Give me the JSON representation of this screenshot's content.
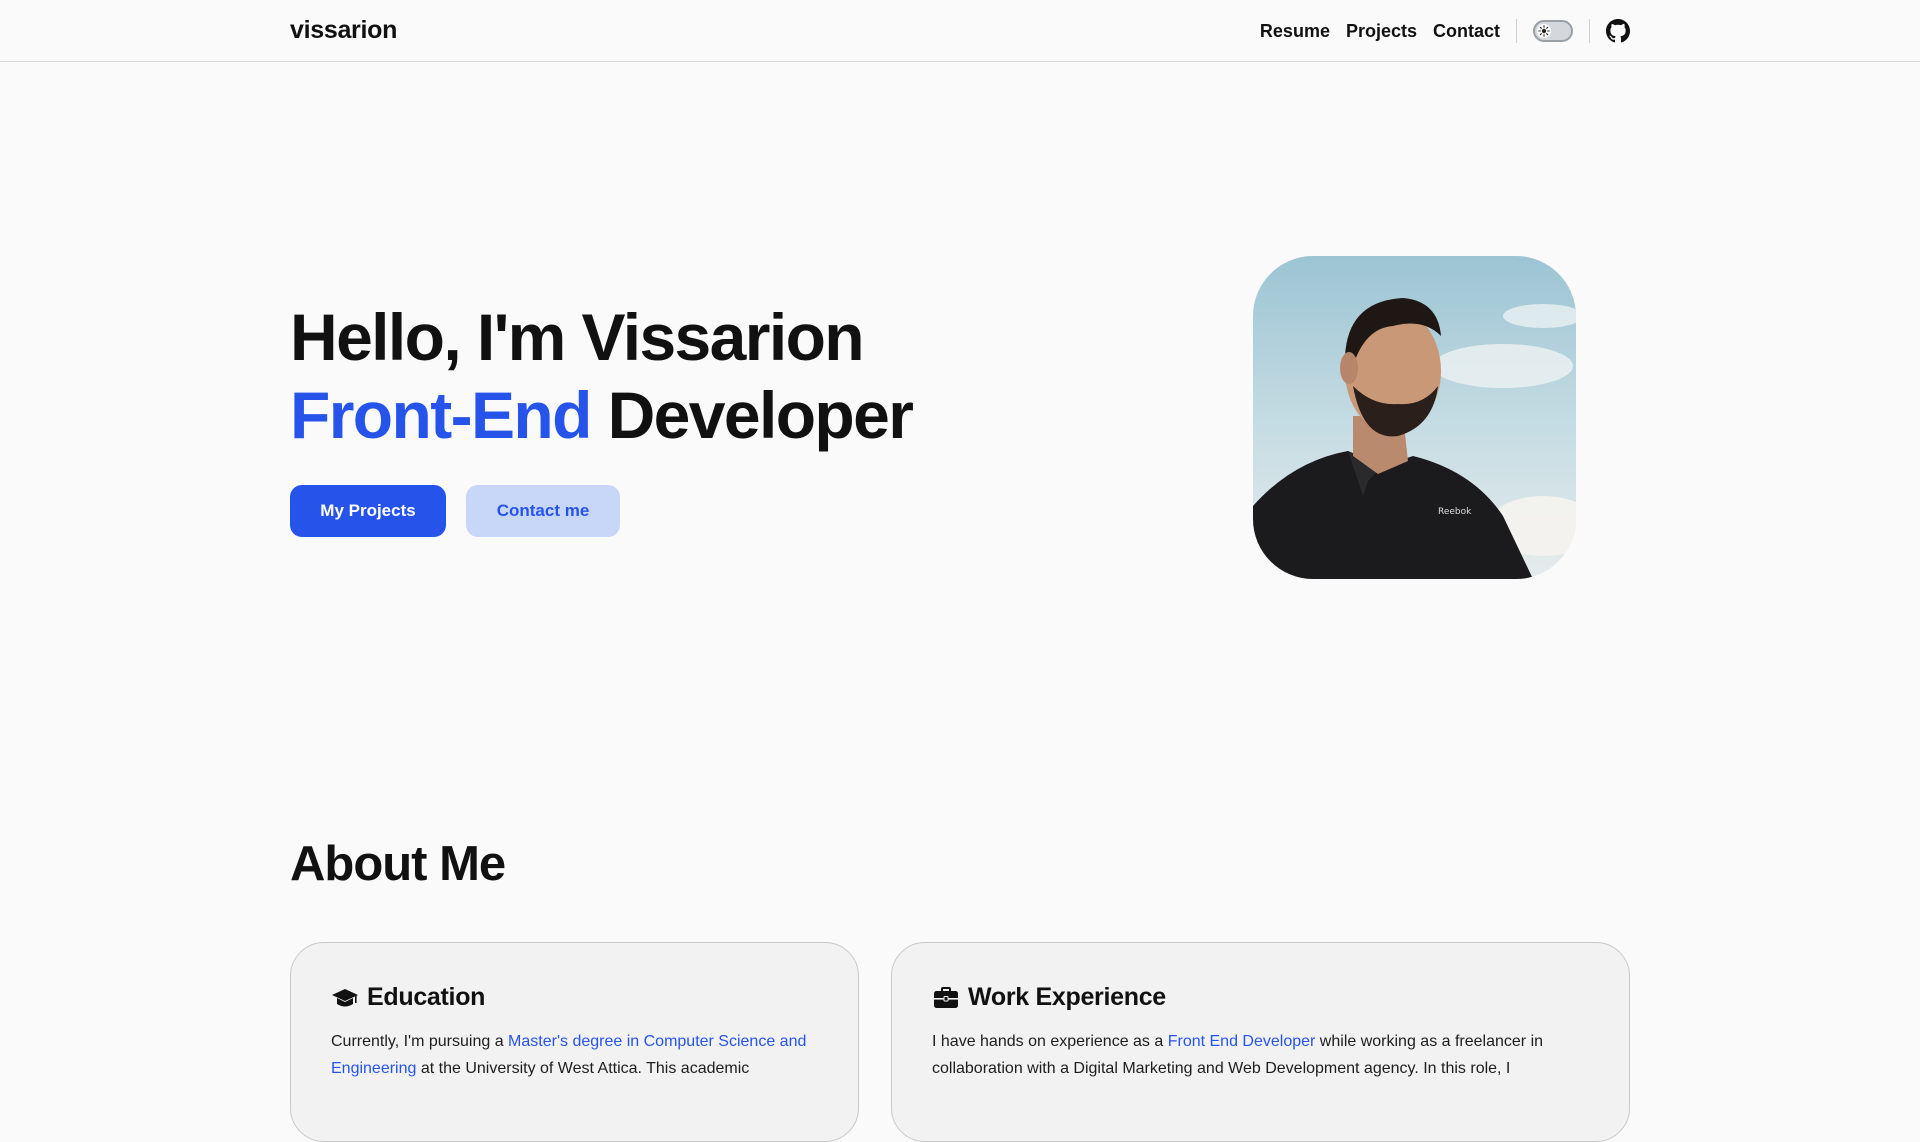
{
  "header": {
    "brand": "vissarion",
    "nav": [
      "Resume",
      "Projects",
      "Contact"
    ],
    "theme_toggle_icon": "sun-icon",
    "github_icon": "github-icon"
  },
  "hero": {
    "line1": "Hello, I'm Vissarion",
    "line2_accent": "Front-End",
    "line2_rest": "Developer",
    "primary_button": "My Projects",
    "secondary_button": "Contact me",
    "accent_color": "#2654eb"
  },
  "about": {
    "title": "About Me",
    "education": {
      "icon": "graduation-cap-icon",
      "title": "Education",
      "text_before": "Currently, I'm pursuing a ",
      "link": "Master's degree in Computer Science and Engineering",
      "text_after": " at the University of West Attica. This academic"
    },
    "work": {
      "icon": "briefcase-icon",
      "title": "Work Experience",
      "text_before": "I have hands on experience as a ",
      "link": "Front End Developer",
      "text_after": " while working as a freelancer in collaboration with a Digital Marketing and Web Development agency. In this role, I"
    }
  }
}
